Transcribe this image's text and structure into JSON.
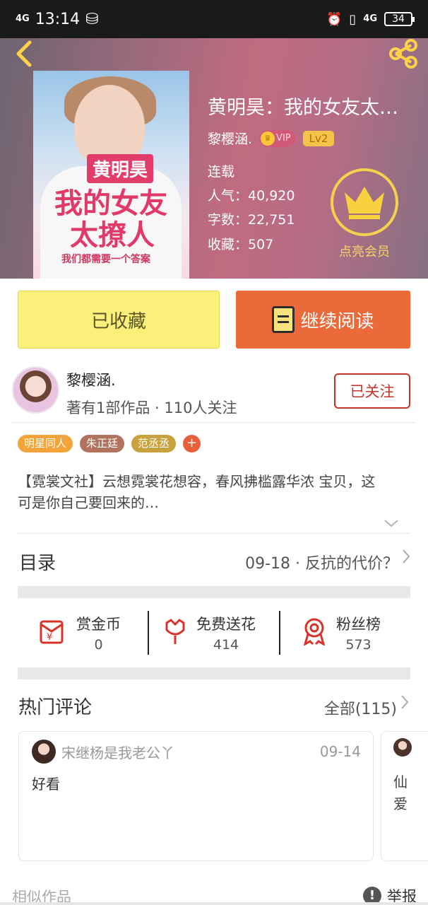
{
  "status_bar": {
    "signal_label": "4G",
    "time": "13:14",
    "net_label": "4G",
    "battery": "34"
  },
  "book": {
    "title": "黄明昊：我的女友太…",
    "author": "黎樱涵.",
    "vip_label": "VIP",
    "level": "Lv2",
    "status": "连载",
    "popularity": "人气：40,920",
    "words": "字数：22,751",
    "favorites": "收藏：507",
    "cover": {
      "tag": "黄明昊",
      "line1": "我的女友",
      "line2": "太撩人",
      "line3": "我们都需要一个答案"
    }
  },
  "member": {
    "label": "点亮会员"
  },
  "actions": {
    "favorited": "已收藏",
    "continue_reading": "继续阅读"
  },
  "author_card": {
    "name": "黎樱涵.",
    "meta": "著有1部作品 · 110人关注",
    "follow_label": "已关注"
  },
  "tags": [
    {
      "label": "明星同人",
      "color": "#f2a33a"
    },
    {
      "label": "朱正廷",
      "color": "#b1735e"
    },
    {
      "label": "范丞丞",
      "color": "#c9a23d"
    }
  ],
  "tag_add": "+",
  "description": "【霓裳文社】云想霓裳花想容，春风拂槛露华浓 宝贝，这可是你自己要回来的…",
  "toc": {
    "label": "目录",
    "latest": "09-18 · 反抗的代价？"
  },
  "stats": [
    {
      "name": "赏金币",
      "value": "0"
    },
    {
      "name": "免费送花",
      "value": "414"
    },
    {
      "name": "粉丝榜",
      "value": "573"
    }
  ],
  "comments_header": {
    "label": "热门评论",
    "all": "全部(115)"
  },
  "comments": [
    {
      "user": "宋继杨是我老公丫",
      "date": "09-14",
      "text": "好看"
    },
    {
      "text": "仙爱"
    }
  ],
  "footer": {
    "similar": "相似作品",
    "report": "举报"
  },
  "colors": {
    "accent_orange": "#ec6a3a",
    "fav_yellow": "#fbf07a",
    "follow_red": "#c4342a",
    "gold": "#f4d24e"
  }
}
